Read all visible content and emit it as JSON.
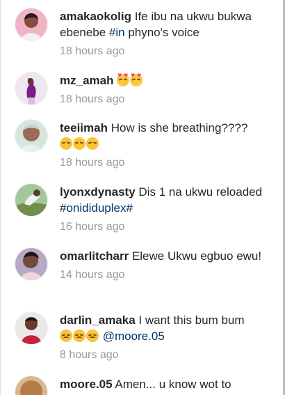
{
  "comments": [
    {
      "username": "amakaokolig",
      "text_before": "Ife ibu na ukwu bukwa ebenebe ",
      "hashtag": "#in",
      "text_after": " phyno's voice",
      "time": "18 hours ago",
      "avatar_icon": "profile-photo"
    },
    {
      "username": "mz_amah",
      "text_before": "",
      "hashtag": "",
      "text_after": "",
      "emoji": [
        "heart-eyes-face",
        "heart-eyes-face"
      ],
      "time": "18 hours ago",
      "avatar_icon": "profile-photo"
    },
    {
      "username": "teeiimah",
      "text_before": "How is she breathing????",
      "hashtag": "",
      "text_after": "",
      "emoji": [
        "grinning-squint-face",
        "grinning-squint-face",
        "grinning-squint-face"
      ],
      "time": "18 hours ago",
      "avatar_icon": "profile-photo"
    },
    {
      "username": "lyonxdynasty",
      "text_before": "Dis 1 na ukwu reloaded ",
      "hashtag": "#onididuplex#",
      "text_after": "",
      "time": "16 hours ago",
      "avatar_icon": "profile-photo"
    },
    {
      "username": "omarlitcharr",
      "text_before": "Elewe Ukwu egbuo ewu!",
      "hashtag": "",
      "text_after": "",
      "time": "14 hours ago",
      "avatar_icon": "profile-photo"
    },
    {
      "username": "darlin_amaka",
      "text_before": "I want this bum bum",
      "hashtag": "",
      "text_after": "",
      "emoji": [
        "sad-face",
        "sad-face",
        "sad-face"
      ],
      "mention": "@moore.05",
      "time": "8 hours ago",
      "avatar_icon": "profile-photo"
    },
    {
      "username": "moore.05",
      "text_before": "Amen... u know wot to",
      "hashtag": "",
      "text_after": "",
      "time": "",
      "avatar_icon": "profile-photo"
    }
  ]
}
